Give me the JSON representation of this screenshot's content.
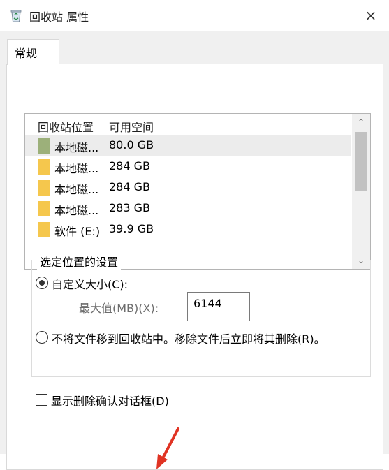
{
  "window": {
    "title": "回收站 属性",
    "close_glyph": "×",
    "icon": "recycle-bin-icon"
  },
  "tabs": [
    {
      "label": "常规",
      "active": true
    }
  ],
  "location_list": {
    "columns": [
      "回收站位置",
      "可用空间"
    ],
    "rows": [
      {
        "name": "本地磁...",
        "space": "80.0 GB",
        "icon": "drive-icon",
        "icon_color": "#9cb07a",
        "selected": true
      },
      {
        "name": "本地磁...",
        "space": "284 GB",
        "icon": "folder-icon",
        "icon_color": "#f5c74d",
        "selected": false
      },
      {
        "name": "本地磁...",
        "space": "284 GB",
        "icon": "folder-icon",
        "icon_color": "#f5c74d",
        "selected": false
      },
      {
        "name": "本地磁...",
        "space": "283 GB",
        "icon": "folder-icon",
        "icon_color": "#f5c74d",
        "selected": false
      },
      {
        "name": "软件 (E:)",
        "space": "39.9 GB",
        "icon": "folder-icon",
        "icon_color": "#f5c74d",
        "selected": false
      }
    ],
    "scroll_up_glyph": "⌃",
    "scroll_down_glyph": "⌄"
  },
  "settings_group": {
    "title": "选定位置的设置",
    "custom_size": {
      "label": "自定义大小(C):",
      "checked": true
    },
    "max_size": {
      "label": "最大值(MB)(X):",
      "value": "6144"
    },
    "no_move": {
      "label": "不将文件移到回收站中。移除文件后立即将其删除(R)。",
      "checked": false
    }
  },
  "confirm_delete": {
    "label": "显示删除确认对话框(D)",
    "checked": false
  },
  "annotation": {
    "color": "#e03323"
  }
}
